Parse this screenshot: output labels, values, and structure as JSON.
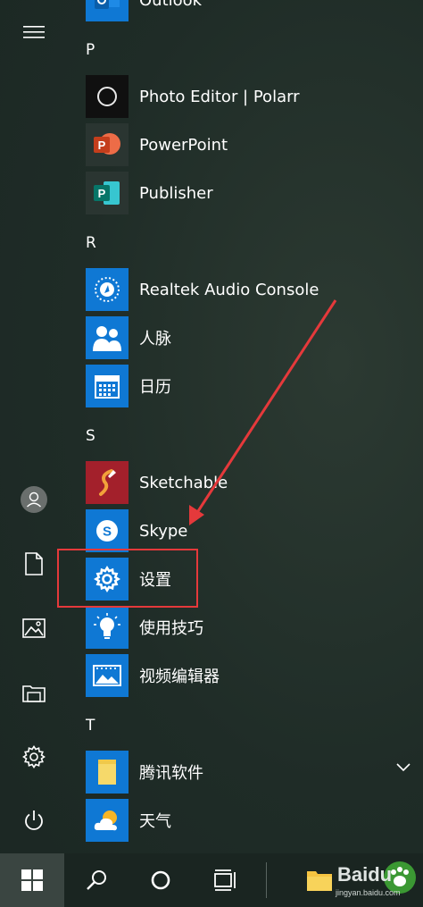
{
  "apps": {
    "outlook": "Outlook",
    "photo_editor": "Photo Editor | Polarr",
    "powerpoint": "PowerPoint",
    "publisher": "Publisher",
    "realtek": "Realtek Audio Console",
    "people": "人脉",
    "calendar": "日历",
    "sketchable": "Sketchable",
    "skype": "Skype",
    "settings": "设置",
    "tips": "使用技巧",
    "video_editor": "视频编辑器",
    "tencent": "腾讯软件",
    "weather": "天气"
  },
  "headers": {
    "p": "P",
    "r": "R",
    "s": "S",
    "t": "T"
  },
  "watermark": {
    "brand": "Baidu",
    "url": "jingyan.baidu.com"
  },
  "colors": {
    "accent_blue": "#0f78d4",
    "annotation_red": "#e5393b",
    "powerpoint": "#c43e1c",
    "publisher": "#077568",
    "sketchable": "#a3202b",
    "start_menu_bg": "#1f2c27"
  }
}
